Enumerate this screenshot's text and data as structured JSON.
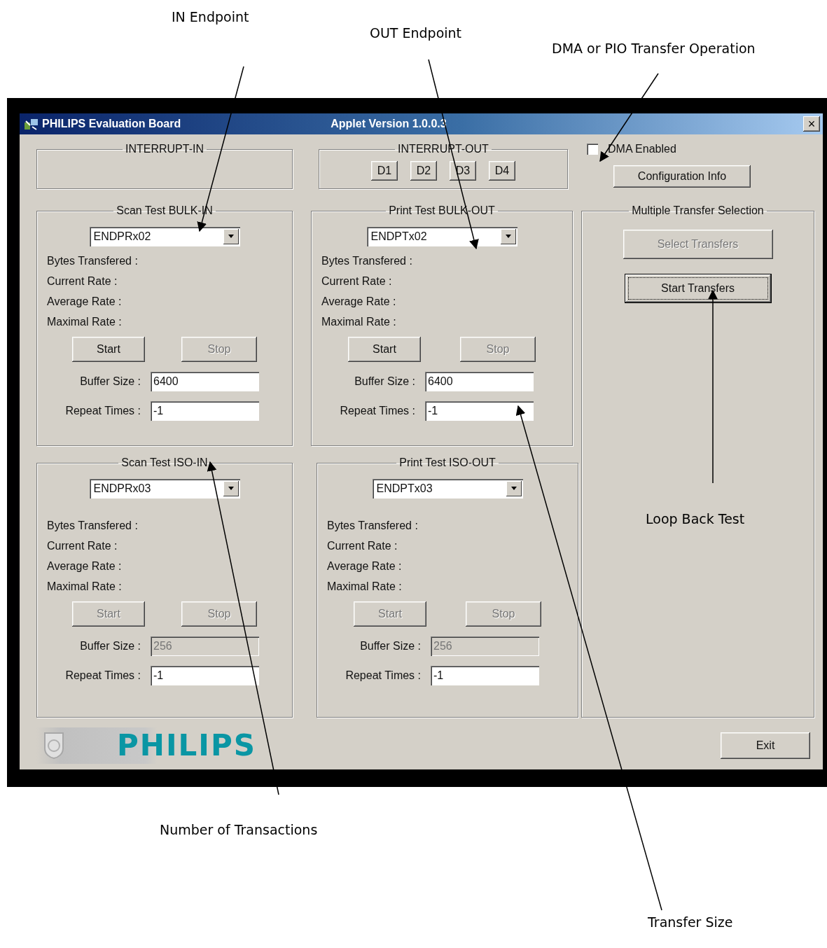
{
  "annotations": [
    {
      "text": "IN Endpoint"
    },
    {
      "text": "OUT Endpoint"
    },
    {
      "text": "DMA or PIO Transfer Operation"
    },
    {
      "text": "Loop Back Test"
    },
    {
      "text": "Number of Transactions"
    },
    {
      "text": "Transfer Size"
    }
  ],
  "window": {
    "title": "PHILIPS Evaluation Board",
    "subtitle": "Applet Version 1.0.0.3",
    "close_glyph": "×"
  },
  "interrupt_in": {
    "title": "INTERRUPT-IN"
  },
  "interrupt_out": {
    "title": "INTERRUPT-OUT",
    "buttons": [
      "D1",
      "D2",
      "D3",
      "D4"
    ]
  },
  "dma": {
    "label": "DMA Enabled",
    "checked": false
  },
  "config_button": "Configuration Info",
  "transfers": [
    {
      "title": "Scan Test BULK-IN",
      "endpoint": "ENDPRx02",
      "stats": [
        "Bytes Transfered :",
        "Current Rate :",
        "Average Rate :",
        "Maximal Rate :"
      ],
      "start": {
        "label": "Start",
        "disabled": false
      },
      "stop": {
        "label": "Stop",
        "disabled": true
      },
      "buffer_label": "Buffer Size :",
      "buffer_value": "6400",
      "buffer_disabled": false,
      "repeat_label": "Repeat Times :",
      "repeat_value": "-1"
    },
    {
      "title": "Print Test BULK-OUT",
      "endpoint": "ENDPTx02",
      "stats": [
        "Bytes Transfered :",
        "Current Rate :",
        "Average Rate :",
        "Maximal Rate :"
      ],
      "start": {
        "label": "Start",
        "disabled": false
      },
      "stop": {
        "label": "Stop",
        "disabled": true
      },
      "buffer_label": "Buffer Size :",
      "buffer_value": "6400",
      "buffer_disabled": false,
      "repeat_label": "Repeat Times :",
      "repeat_value": "-1"
    },
    {
      "title": "Scan Test ISO-IN",
      "endpoint": "ENDPRx03",
      "stats": [
        "Bytes Transfered :",
        "Current Rate :",
        "Average Rate :",
        "Maximal Rate :"
      ],
      "start": {
        "label": "Start",
        "disabled": true
      },
      "stop": {
        "label": "Stop",
        "disabled": true
      },
      "buffer_label": "Buffer Size :",
      "buffer_value": "256",
      "buffer_disabled": true,
      "repeat_label": "Repeat Times :",
      "repeat_value": "-1"
    },
    {
      "title": "Print Test ISO-OUT",
      "endpoint": "ENDPTx03",
      "stats": [
        "Bytes Transfered :",
        "Current Rate :",
        "Average Rate :",
        "Maximal Rate :"
      ],
      "start": {
        "label": "Start",
        "disabled": true
      },
      "stop": {
        "label": "Stop",
        "disabled": true
      },
      "buffer_label": "Buffer Size :",
      "buffer_value": "256",
      "buffer_disabled": true,
      "repeat_label": "Repeat Times :",
      "repeat_value": "-1"
    }
  ],
  "multi": {
    "title": "Multiple Transfer Selection",
    "select": {
      "label": "Select Transfers",
      "disabled": true,
      "focused": false
    },
    "start": {
      "label": "Start Transfers",
      "disabled": false,
      "focused": true
    }
  },
  "logo": {
    "text": "PHILIPS"
  },
  "exit_button": "Exit"
}
